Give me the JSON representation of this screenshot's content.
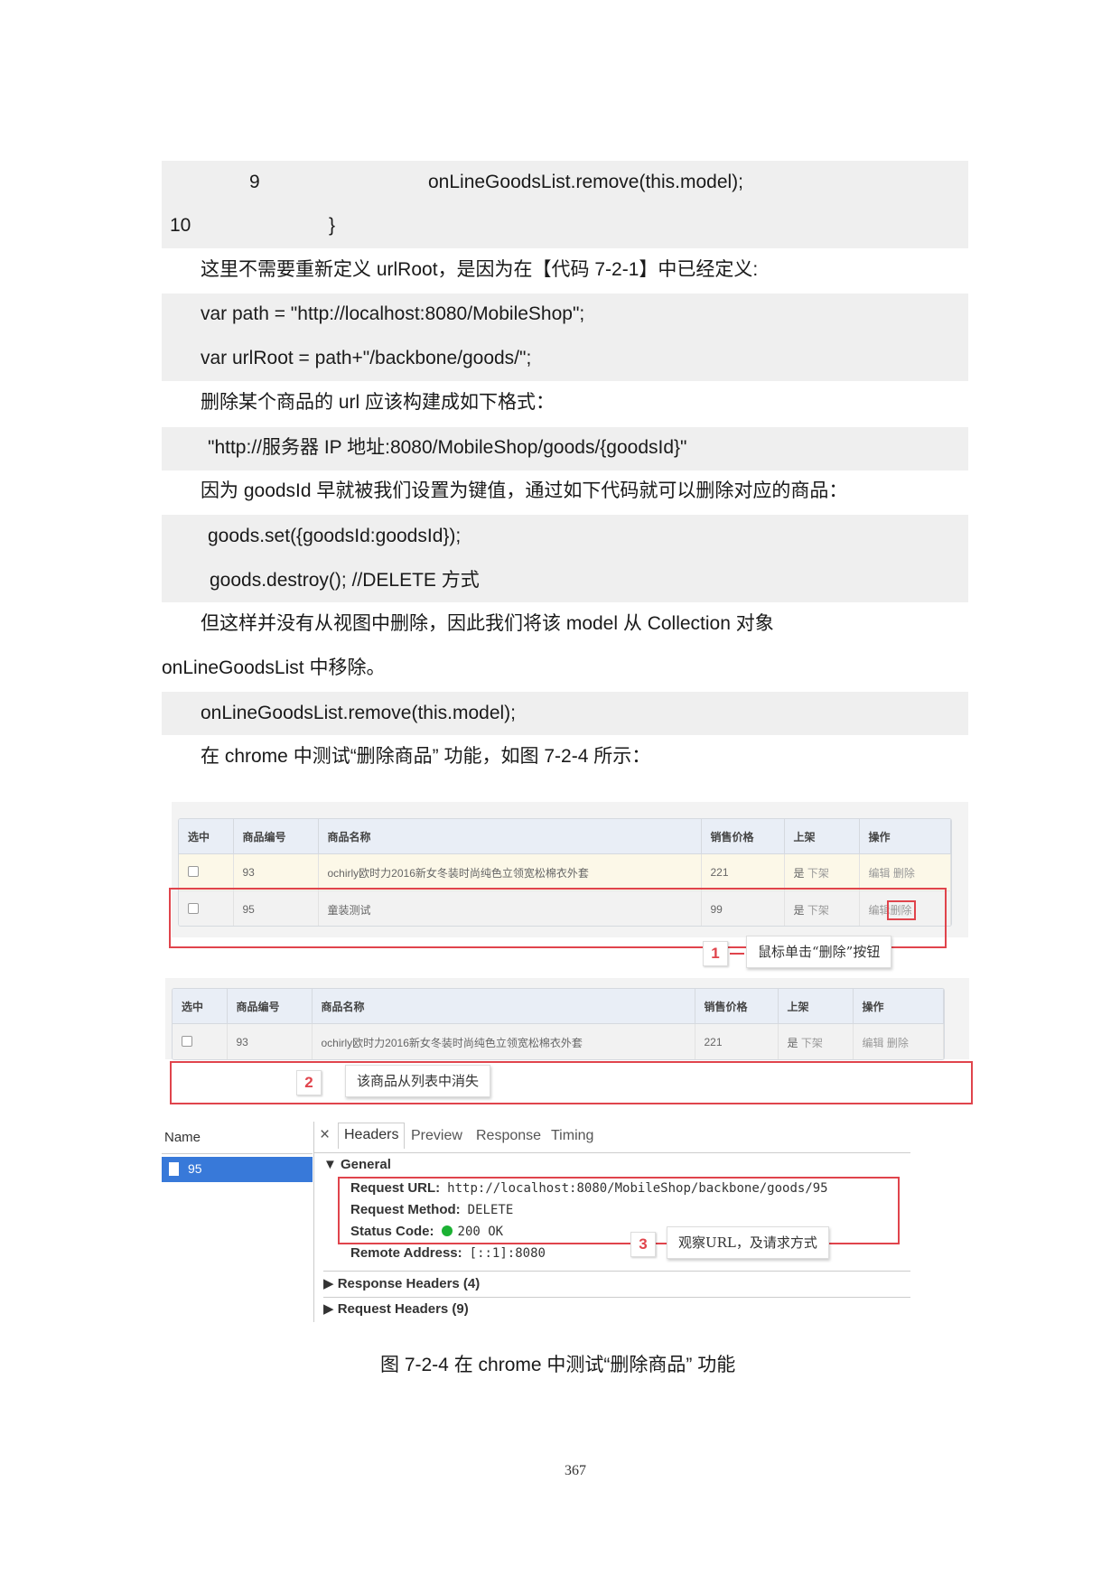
{
  "code_block_1": {
    "line_9_num": "9",
    "line_9_code": "onLineGoodsList.remove(this.model);",
    "line_10_num": "10",
    "line_10_code": "}"
  },
  "para_1": "这里不需要重新定义 urlRoot，是因为在【代码 7-2-1】中已经定义:",
  "code_block_2": {
    "line_1": "var path = \"http://localhost:8080/MobileShop\";",
    "line_2": "var urlRoot = path+\"/backbone/goods/\";"
  },
  "para_2": "删除某个商品的 url 应该构建成如下格式：",
  "code_block_3": {
    "line_1": "\"http://服务器 IP 地址:8080/MobileShop/goods/{goodsId}\""
  },
  "para_3": "因为 goodsId 早就被我们设置为键值，通过如下代码就可以删除对应的商品：",
  "code_block_4": {
    "line_1": "goods.set({goodsId:goodsId});",
    "line_2": "goods.destroy(); //DELETE 方式"
  },
  "para_4a": "但这样并没有从视图中删除，因此我们将该 model 从 Collection 对象",
  "para_4b": "onLineGoodsList 中移除。",
  "code_block_5": {
    "line_1": "onLineGoodsList.remove(this.model);"
  },
  "para_5": "在 chrome 中测试“删除商品” 功能，如图 7-2-4 所示：",
  "table_headers": [
    "选中",
    "商品编号",
    "商品名称",
    "销售价格",
    "上架",
    "操作"
  ],
  "table1_rows": [
    {
      "id": "93",
      "name": "ochirly欧时力2016新女冬装时尚纯色立领宽松棉衣外套",
      "price": "221",
      "shelf_on": "是",
      "shelf_off": "下架",
      "edit": "编辑",
      "delete": "删除"
    },
    {
      "id": "95",
      "name": "童装测试",
      "price": "99",
      "shelf_on": "是",
      "shelf_off": "下架",
      "edit": "编辑",
      "delete": "删除"
    }
  ],
  "table2_rows": [
    {
      "id": "93",
      "name": "ochirly欧时力2016新女冬装时尚纯色立领宽松棉衣外套",
      "price": "221",
      "shelf_on": "是",
      "shelf_off": "下架",
      "edit": "编辑",
      "delete": "删除"
    }
  ],
  "callouts": {
    "c1_num": "1",
    "c1_text": "鼠标单击“删除”按钮",
    "c2_num": "2",
    "c2_text": "该商品从列表中消失",
    "c3_num": "3",
    "c3_text": "观察URL，及请求方式"
  },
  "devtools": {
    "name_header": "Name",
    "item": "95",
    "close": "×",
    "tabs": [
      "Headers",
      "Preview",
      "Response",
      "Timing"
    ],
    "general": "▼ General",
    "request_url_label": "Request URL:",
    "request_url": "http://localhost:8080/MobileShop/backbone/goods/95",
    "request_method_label": "Request Method:",
    "request_method": "DELETE",
    "status_code_label": "Status Code:",
    "status_code": "200 OK",
    "status_color": "#1bb133",
    "remote_address_label": "Remote Address:",
    "remote_address": "[::1]:8080",
    "response_headers": "▶ Response Headers (4)",
    "request_headers": "▶ Request Headers (9)"
  },
  "caption": "图 7-2-4    在 chrome 中测试“删除商品” 功能",
  "page_number": "367"
}
